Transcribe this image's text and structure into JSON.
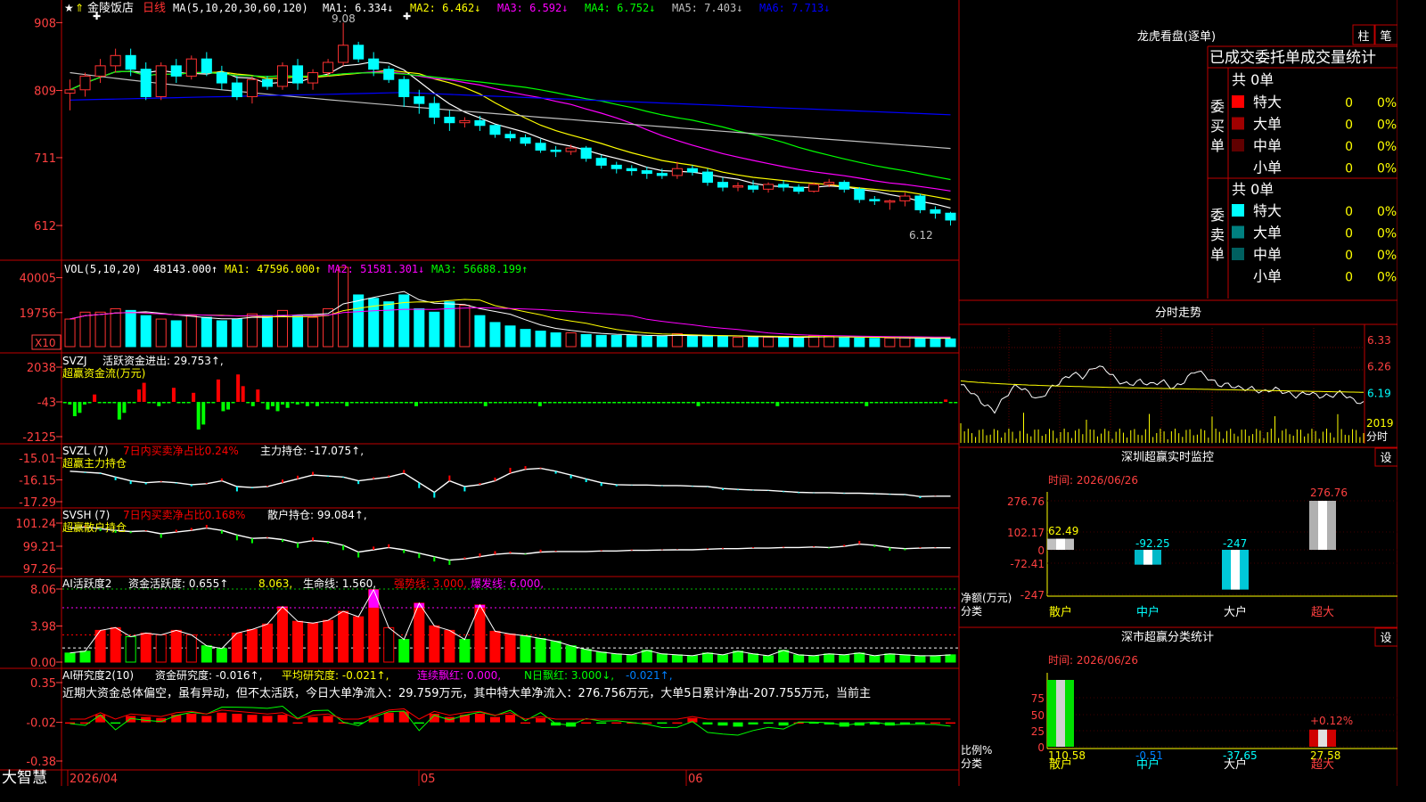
{
  "header": {
    "stock_name": "金陵饭店",
    "period": "日线",
    "ma_params": "MA(5,10,20,30,60,120)",
    "ma_items": [
      {
        "label": "MA1: 6.334↓",
        "color": "#ffffff"
      },
      {
        "label": "MA2: 6.462↓",
        "color": "#ffff00"
      },
      {
        "label": "MA3: 6.592↓",
        "color": "#ff00ff"
      },
      {
        "label": "MA4: 6.752↓",
        "color": "#00ff00"
      },
      {
        "label": "MA5: 7.403↓",
        "color": "#c0c0c0"
      },
      {
        "label": "MA6: 7.713↓",
        "color": "#0000ff"
      }
    ],
    "price_high_label": "9.08",
    "price_low_label": "6.12"
  },
  "colors": {
    "up": "#ff3232",
    "down": "#00ffff",
    "grid": "#c00000",
    "axis_text": "#ff4040",
    "green": "#00ff00",
    "magenta": "#ff00ff"
  },
  "chart_data": [
    {
      "type": "candlestick",
      "name": "price",
      "y_ticks": [
        "908",
        "809",
        "711",
        "612"
      ],
      "ylim": [
        5.9,
        9.15
      ],
      "candles": [
        [
          8.05,
          8.25,
          7.8,
          8.1
        ],
        [
          8.1,
          8.35,
          8.0,
          8.3
        ],
        [
          8.3,
          8.55,
          8.2,
          8.45
        ],
        [
          8.45,
          8.7,
          8.35,
          8.6
        ],
        [
          8.6,
          8.7,
          8.3,
          8.4
        ],
        [
          8.4,
          8.5,
          7.95,
          8.0
        ],
        [
          8.0,
          8.5,
          7.95,
          8.45
        ],
        [
          8.45,
          8.55,
          8.2,
          8.3
        ],
        [
          8.3,
          8.6,
          8.25,
          8.55
        ],
        [
          8.55,
          8.65,
          8.3,
          8.35
        ],
        [
          8.35,
          8.45,
          8.1,
          8.2
        ],
        [
          8.2,
          8.3,
          7.95,
          8.0
        ],
        [
          8.0,
          8.3,
          7.9,
          8.25
        ],
        [
          8.25,
          8.3,
          8.1,
          8.15
        ],
        [
          8.15,
          8.5,
          8.1,
          8.45
        ],
        [
          8.45,
          8.55,
          8.1,
          8.2
        ],
        [
          8.2,
          8.4,
          8.1,
          8.35
        ],
        [
          8.35,
          8.55,
          8.3,
          8.5
        ],
        [
          8.5,
          9.08,
          8.45,
          8.75
        ],
        [
          8.75,
          8.8,
          8.5,
          8.55
        ],
        [
          8.55,
          8.65,
          8.3,
          8.4
        ],
        [
          8.4,
          8.45,
          8.2,
          8.25
        ],
        [
          8.25,
          8.3,
          7.85,
          8.0
        ],
        [
          8.0,
          8.1,
          7.75,
          7.9
        ],
        [
          7.9,
          8.0,
          7.6,
          7.7
        ],
        [
          7.7,
          7.8,
          7.5,
          7.62
        ],
        [
          7.62,
          7.7,
          7.55,
          7.65
        ],
        [
          7.65,
          7.72,
          7.5,
          7.58
        ],
        [
          7.58,
          7.6,
          7.4,
          7.45
        ],
        [
          7.45,
          7.5,
          7.35,
          7.4
        ],
        [
          7.4,
          7.45,
          7.28,
          7.32
        ],
        [
          7.32,
          7.38,
          7.18,
          7.22
        ],
        [
          7.22,
          7.28,
          7.12,
          7.2
        ],
        [
          7.2,
          7.3,
          7.15,
          7.25
        ],
        [
          7.25,
          7.28,
          7.05,
          7.1
        ],
        [
          7.1,
          7.15,
          6.95,
          7.0
        ],
        [
          7.0,
          7.05,
          6.88,
          6.95
        ],
        [
          6.95,
          7.0,
          6.85,
          6.92
        ],
        [
          6.92,
          6.98,
          6.8,
          6.88
        ],
        [
          6.88,
          6.95,
          6.8,
          6.85
        ],
        [
          6.85,
          7.05,
          6.8,
          6.95
        ],
        [
          6.95,
          7.0,
          6.85,
          6.9
        ],
        [
          6.9,
          6.95,
          6.7,
          6.75
        ],
        [
          6.75,
          6.82,
          6.62,
          6.68
        ],
        [
          6.68,
          6.75,
          6.62,
          6.7
        ],
        [
          6.7,
          6.78,
          6.6,
          6.65
        ],
        [
          6.65,
          6.75,
          6.6,
          6.72
        ],
        [
          6.72,
          6.78,
          6.62,
          6.68
        ],
        [
          6.68,
          6.72,
          6.58,
          6.62
        ],
        [
          6.62,
          6.75,
          6.6,
          6.72
        ],
        [
          6.72,
          6.8,
          6.68,
          6.75
        ],
        [
          6.75,
          6.78,
          6.6,
          6.65
        ],
        [
          6.65,
          6.68,
          6.45,
          6.5
        ],
        [
          6.5,
          6.55,
          6.42,
          6.48
        ],
        [
          6.48,
          6.5,
          6.35,
          6.48
        ],
        [
          6.48,
          6.6,
          6.4,
          6.55
        ],
        [
          6.55,
          6.58,
          6.3,
          6.35
        ],
        [
          6.35,
          6.4,
          6.22,
          6.3
        ],
        [
          6.3,
          6.32,
          6.12,
          6.2
        ]
      ]
    },
    {
      "type": "bar",
      "name": "volume",
      "y_ticks": [
        "40005",
        "19756"
      ],
      "multiplier_label": "X10",
      "ylim": [
        0,
        46000
      ],
      "values": [
        16000,
        20000,
        20000,
        22000,
        21000,
        18000,
        16000,
        15000,
        18000,
        17000,
        15000,
        16000,
        19000,
        18000,
        21000,
        18000,
        17000,
        22000,
        46000,
        30000,
        28000,
        26000,
        30000,
        22000,
        20000,
        26000,
        24000,
        18000,
        14000,
        12000,
        10000,
        9000,
        8000,
        8000,
        7000,
        6500,
        6500,
        6500,
        6000,
        6000,
        7500,
        6000,
        6000,
        6000,
        5500,
        5500,
        5500,
        5500,
        5000,
        6500,
        6000,
        5200,
        5000,
        4800,
        5000,
        5200,
        4800,
        4600,
        4500
      ],
      "ma_note": "VOL(5,10,20)",
      "stats": [
        {
          "label": "48143.000↑",
          "color": "#ffffff"
        },
        {
          "label": "MA1: 47596.000↑",
          "color": "#ffff00"
        },
        {
          "label": "MA2: 51581.301↓",
          "color": "#ff00ff"
        },
        {
          "label": "MA3: 56688.199↑",
          "color": "#00ff00"
        }
      ]
    },
    {
      "type": "bar",
      "name": "active-fund-flow",
      "title": "SVZJ",
      "line1": "活跃资金进出: 29.753↑,",
      "line2": "超赢资金流(万元)",
      "y_ticks": [
        "2038",
        "-43",
        "-2125"
      ],
      "ylim": [
        -2125,
        2038
      ],
      "zero": -43,
      "values": [
        -60,
        -200,
        -900,
        -700,
        -200,
        -60,
        400,
        -60,
        -60,
        -60,
        -60,
        -1100,
        -700,
        -60,
        -60,
        700,
        1100,
        -60,
        -60,
        -300,
        -60,
        -60,
        800,
        -60,
        -60,
        -60,
        500,
        -1700,
        -1400,
        -60,
        -60,
        1300,
        -600,
        -500,
        -60,
        1600,
        900,
        -60,
        -300,
        700,
        -60,
        -500,
        -300,
        -600,
        -200,
        -400,
        -60,
        -200,
        -60,
        -300,
        -60,
        -300,
        -60,
        -60,
        -60,
        -60,
        -60,
        -300,
        -60,
        -60,
        -60,
        -60,
        -60,
        -60,
        -60,
        -60,
        -60,
        -60,
        -60,
        -60,
        -60,
        -300,
        -60,
        -60,
        -60,
        -60,
        -60,
        -60,
        -60,
        -60,
        -60,
        -60,
        -60,
        -60,
        -60,
        -300,
        -60,
        -60,
        -60,
        -60,
        -60,
        -60,
        -60,
        -60,
        -60,
        -60,
        -300,
        -60,
        -60,
        -60,
        -60,
        -60,
        -60,
        -60,
        -60,
        -60,
        -60,
        -60,
        -60,
        -60,
        -60,
        -60,
        -60,
        -60,
        -60,
        -60,
        -60,
        -60,
        -60,
        -60,
        -60,
        -60,
        -60,
        -60,
        -60,
        -60,
        -60,
        -60,
        -300,
        -60,
        -60,
        -60,
        -60,
        -60,
        -60,
        -60,
        -60,
        -60,
        -60,
        -60,
        -60,
        -60,
        -60,
        -60,
        -300,
        -60,
        -60,
        -60,
        -60,
        -60,
        -60,
        -60,
        -60,
        -60,
        -60,
        -60,
        -60,
        -60,
        -60,
        -60,
        -60,
        -60,
        -300,
        -60,
        -60,
        -60,
        -60,
        -60,
        -60,
        -60,
        -60,
        -60,
        -60,
        -60,
        -60,
        -60,
        -60,
        -60,
        100,
        -60,
        -60
      ]
    },
    {
      "type": "line",
      "name": "main-holding",
      "title": "SVZL (7)",
      "pct_label": "7日内买卖净占比0.24%",
      "holding_label": "主力持仓: -17.075↑,",
      "line2": "超赢主力持仓",
      "y_ticks": [
        "-15.01",
        "-16.15",
        "-17.29"
      ],
      "ylim": [
        -17.29,
        -15.01
      ],
      "values": [
        -15.7,
        -15.75,
        -15.8,
        -16.0,
        -16.2,
        -16.3,
        -16.25,
        -16.3,
        -16.4,
        -16.35,
        -16.2,
        -16.5,
        -16.55,
        -16.5,
        -16.3,
        -16.1,
        -15.9,
        -15.95,
        -16.0,
        -16.2,
        -16.1,
        -16.0,
        -15.8,
        -16.3,
        -16.8,
        -16.2,
        -16.5,
        -16.4,
        -16.2,
        -15.8,
        -15.6,
        -15.55,
        -15.7,
        -15.9,
        -16.1,
        -16.3,
        -16.4,
        -16.42,
        -16.42,
        -16.45,
        -16.45,
        -16.48,
        -16.5,
        -16.6,
        -16.65,
        -16.68,
        -16.7,
        -16.75,
        -16.8,
        -16.82,
        -16.82,
        -16.85,
        -16.85,
        -16.87,
        -16.9,
        -16.92,
        -17.02,
        -17.0,
        -17.0
      ],
      "stock_label_color": "#ff0000"
    },
    {
      "type": "line",
      "name": "retail-holding",
      "title": "SVSH (7)",
      "pct_label": "7日内买卖净占比0.168%",
      "holding_label": "散户持仓: 99.084↑,",
      "line2": "超赢散户持仓",
      "y_ticks": [
        "101.24",
        "99.21",
        "97.26"
      ],
      "ylim": [
        97.26,
        101.24
      ],
      "values": [
        100.8,
        100.9,
        100.75,
        100.6,
        100.5,
        100.55,
        100.3,
        100.45,
        100.6,
        100.8,
        100.6,
        100.2,
        99.9,
        99.95,
        99.8,
        99.5,
        99.7,
        99.6,
        99.3,
        98.7,
        98.9,
        99.1,
        98.9,
        98.6,
        98.3,
        98.0,
        98.1,
        98.3,
        98.5,
        98.6,
        98.55,
        98.7,
        98.75,
        98.75,
        98.75,
        98.8,
        98.8,
        98.85,
        98.85,
        98.88,
        98.9,
        98.9,
        98.95,
        99.0,
        99.0,
        99.05,
        99.05,
        99.1,
        99.1,
        99.15,
        99.1,
        99.2,
        99.4,
        99.3,
        99.1,
        99.0,
        99.05,
        99.08,
        99.08
      ],
      "stock_label_color": "#ff0000"
    },
    {
      "type": "bar",
      "name": "ai-activity",
      "title": "AI活跃度2",
      "stats": [
        {
          "label": "资金活跃度: 0.655↑",
          "color": "#ffffff"
        },
        {
          "label": "8.063,",
          "color": "#ffff00"
        },
        {
          "label": "生命线: 1.560,",
          "color": "#ffffff"
        },
        {
          "label": "强势线: 3.000,",
          "color": "#ff0000"
        },
        {
          "label": "爆发线: 6.000,",
          "color": "#ff00ff"
        }
      ],
      "y_ticks": [
        "8.06",
        "3.98",
        "0.00"
      ],
      "ylim": [
        0,
        8.06
      ],
      "lifeline": 1.56,
      "strong_line": 3.0,
      "burst_line": 6.0,
      "values": [
        1.0,
        1.2,
        3.5,
        3.8,
        2.8,
        3.2,
        3.0,
        3.5,
        3.0,
        1.8,
        1.5,
        3.2,
        3.6,
        4.2,
        6.1,
        4.5,
        4.3,
        4.6,
        5.6,
        5.0,
        8.0,
        3.8,
        2.5,
        6.5,
        4.0,
        3.5,
        2.5,
        6.3,
        3.4,
        3.1,
        2.9,
        2.6,
        2.3,
        1.8,
        1.4,
        1.1,
        0.9,
        0.8,
        1.3,
        0.9,
        0.8,
        0.7,
        1.0,
        0.8,
        1.2,
        0.9,
        0.7,
        1.3,
        0.8,
        0.7,
        0.9,
        0.8,
        1.0,
        0.7,
        0.9,
        0.8,
        0.7,
        0.7,
        0.8
      ]
    },
    {
      "type": "bar",
      "name": "ai-research",
      "title": "AI研究度2(10)",
      "stats": [
        {
          "label": "资金研究度: -0.016↑,",
          "color": "#ffffff"
        },
        {
          "label": "平均研究度: -0.021↑,",
          "color": "#ffff00"
        },
        {
          "label": "连续飘红: 0.000,",
          "color": "#ff00ff"
        },
        {
          "label": "N日飘红: 3.000↓,",
          "color": "#00ff00"
        },
        {
          "label": "-0.021↑,",
          "color": "#0080ff"
        }
      ],
      "commentary": "近期大资金总体偏空，虽有异动，但不太活跃，今日大单净流入：29.759万元，其中特大单净流入：276.756万元，大单5日累计净出-207.755万元，当前主",
      "y_ticks": [
        "0.35",
        "-0.02",
        "-0.38"
      ],
      "ylim": [
        -0.38,
        0.35
      ],
      "values": [
        -0.02,
        -0.02,
        0.05,
        -0.03,
        0.04,
        0.03,
        0.02,
        0.05,
        0.06,
        0.04,
        0.07,
        0.06,
        0.05,
        0.04,
        0.05,
        -0.02,
        0.03,
        0.04,
        -0.02,
        -0.03,
        0.03,
        0.07,
        0.08,
        -0.03,
        0.06,
        0.03,
        0.05,
        0.06,
        0.03,
        0.05,
        -0.02,
        0.02,
        -0.05,
        -0.06,
        -0.02,
        -0.03,
        -0.02,
        -0.02,
        -0.02,
        -0.03,
        -0.02,
        0.02,
        -0.04,
        -0.05,
        -0.06,
        -0.04,
        -0.03,
        -0.05,
        -0.02,
        -0.03,
        -0.04,
        -0.06,
        -0.05,
        -0.04,
        -0.05,
        -0.04,
        -0.03,
        -0.02,
        -0.02
      ],
      "x_ticks": [
        "2026/04",
        "05",
        "06"
      ]
    },
    {
      "type": "line",
      "name": "intraday",
      "y_ticks": [
        "6.33",
        "6.26",
        "6.19"
      ],
      "ylim": [
        6.12,
        6.36
      ],
      "vol_label": "2019",
      "time_label": "分时",
      "values": [
        6.21,
        6.19,
        6.16,
        6.14,
        6.18,
        6.21,
        6.19,
        6.17,
        6.2,
        6.22,
        6.24,
        6.23,
        6.26,
        6.25,
        6.22,
        6.21,
        6.22,
        6.21,
        6.22,
        6.2,
        6.22,
        6.25,
        6.23,
        6.21,
        6.21,
        6.2,
        6.2,
        6.19,
        6.2,
        6.19,
        6.18,
        6.19,
        6.18,
        6.18,
        6.19,
        6.17,
        6.16
      ]
    },
    {
      "type": "bar",
      "name": "sz-realtime-monitor",
      "categories": [
        "散户",
        "中户",
        "大户",
        "超大"
      ],
      "values": [
        62.49,
        -92.25,
        -247,
        276.76
      ],
      "value_labels": [
        "62.49",
        "-92.25",
        "-247",
        "276.76"
      ],
      "y_ticks": [
        "276.76",
        "102.17",
        "0",
        "-72.41",
        "-247"
      ],
      "ylim": [
        -247,
        276.76
      ]
    },
    {
      "type": "bar",
      "name": "sz-category-stats",
      "categories": [
        "散户",
        "中户",
        "大户",
        "超大"
      ],
      "values": [
        110.58,
        -0.51,
        -37.65,
        27.58
      ],
      "value_labels": [
        "110.58",
        "-0.51",
        "-37.65",
        "27.58"
      ],
      "y_ticks": [
        "75",
        "50",
        "25",
        "0"
      ],
      "ylim": [
        0,
        100
      ],
      "annotation": "+0.12%"
    }
  ],
  "side": {
    "dragon_title": "龙虎看盘(逐单)",
    "toggle1": "柱",
    "toggle2": "笔",
    "stats_header": "已成交委托单成交量统计",
    "buy_label": "委买单",
    "sell_label": "委卖单",
    "buy_total": "共 0单",
    "sell_total": "共 0单",
    "buy_rows": [
      {
        "label": "特大",
        "count": "0",
        "pct": "0%",
        "color": "#ff0000"
      },
      {
        "label": "大单",
        "count": "0",
        "pct": "0%",
        "color": "#a00000"
      },
      {
        "label": "中单",
        "count": "0",
        "pct": "0%",
        "color": "#600000"
      },
      {
        "label": "小单",
        "count": "0",
        "pct": "0%",
        "color": "#000000"
      }
    ],
    "sell_rows": [
      {
        "label": "特大",
        "count": "0",
        "pct": "0%",
        "color": "#00ffff"
      },
      {
        "label": "大单",
        "count": "0",
        "pct": "0%",
        "color": "#008080"
      },
      {
        "label": "中单",
        "count": "0",
        "pct": "0%",
        "color": "#006060"
      },
      {
        "label": "小单",
        "count": "0",
        "pct": "0%",
        "color": "#000000"
      }
    ],
    "intraday_title": "分时走势",
    "monitor_title": "深圳超赢实时监控",
    "monitor_date": "时间: 2026/06/26",
    "monitor_unit": "净额(万元)",
    "monitor_class": "分类",
    "stats_title": "深市超赢分类统计",
    "stats_date": "时间: 2026/06/26",
    "stats_unit": "比例%",
    "stats_class": "分类",
    "settings_label": "设"
  },
  "footer": {
    "brand": "大智慧"
  }
}
